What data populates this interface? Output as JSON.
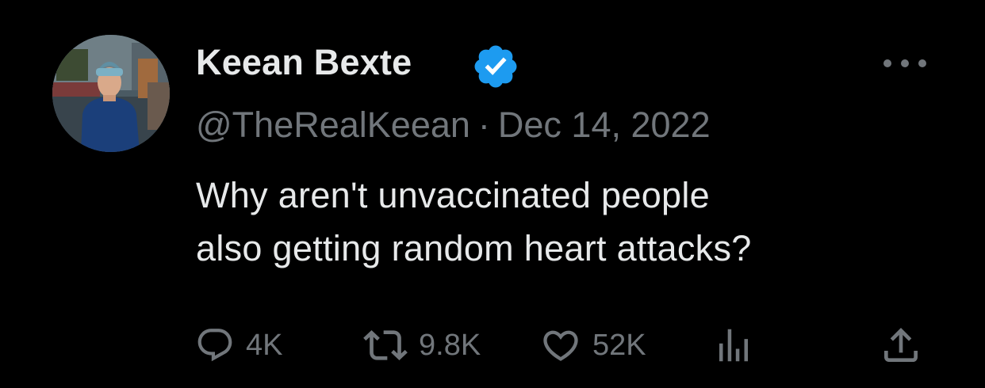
{
  "author": {
    "name": "Keean Bexte",
    "handle": "@TheRealKeean",
    "verified": true
  },
  "meta": {
    "separator": "·",
    "date": "Dec 14, 2022"
  },
  "tweet": {
    "lines": [
      "Why aren't unvaccinated people",
      "also getting random heart attacks?"
    ]
  },
  "actions": {
    "replies": "4K",
    "retweets": "9.8K",
    "likes": "52K"
  },
  "icons": {
    "more": "more-icon",
    "reply": "reply-icon",
    "retweet": "retweet-icon",
    "like": "heart-icon",
    "views": "views-icon",
    "share": "share-icon",
    "verified": "verified-badge-icon"
  },
  "colors": {
    "background": "#000000",
    "text_primary": "#e7e9ea",
    "text_secondary": "#71767b",
    "verified_blue": "#1d9bf0"
  }
}
